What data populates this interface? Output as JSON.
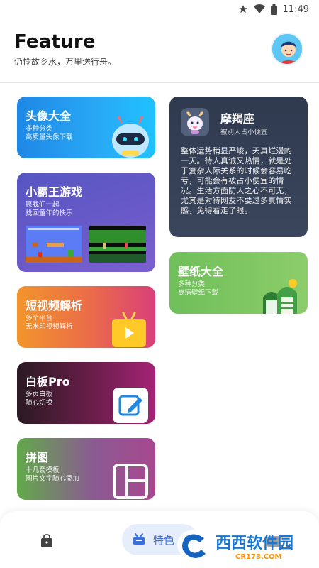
{
  "status_bar": {
    "time": "11:49"
  },
  "header": {
    "title": "Feature",
    "subtitle": "仍怜故乡水，万里送行舟。"
  },
  "cards": {
    "avatar": {
      "title": "头像大全",
      "desc_line1": "多种分类",
      "desc_line2": "高质量头像下载"
    },
    "game": {
      "title": "小霸王游戏",
      "desc_line1": "愿我们一起",
      "desc_line2": "找回童年的快乐"
    },
    "video": {
      "title": "短视频解析",
      "desc_line1": "多个平台",
      "desc_line2": "无水印视频解析"
    },
    "whiteboard": {
      "title": "白板Pro",
      "desc_line1": "多页白板",
      "desc_line2": "随心切换"
    },
    "puzzle": {
      "title": "拼图",
      "desc_line1": "十几套模板",
      "desc_line2": "图片文字随心添加"
    },
    "moyu": {
      "title": "摩羯座",
      "subtitle": "被别人占小便宜",
      "body": "整体运势稍显严峻，天真烂漫的一天。待人真诚又热情，就是处于复杂人际关系的时候会容易吃亏，可能会有被占小便宜的情况。生活方面防人之心不可无，尤其是对待网友不要过多真情实感，免得看走了眼。"
    },
    "wallpaper": {
      "title": "壁纸大全",
      "desc_line1": "多种分类",
      "desc_line2": "高清壁纸下载"
    }
  },
  "bottom_nav": {
    "active_label": "特色",
    "items": [
      "home-bag-icon",
      "feature-icon",
      "third-icon"
    ]
  },
  "watermark": {
    "text": "西西软件园",
    "url": "CR173.COM"
  },
  "colors": {
    "accent": "#3b6fe0",
    "active_pill": "#e6eefc"
  }
}
